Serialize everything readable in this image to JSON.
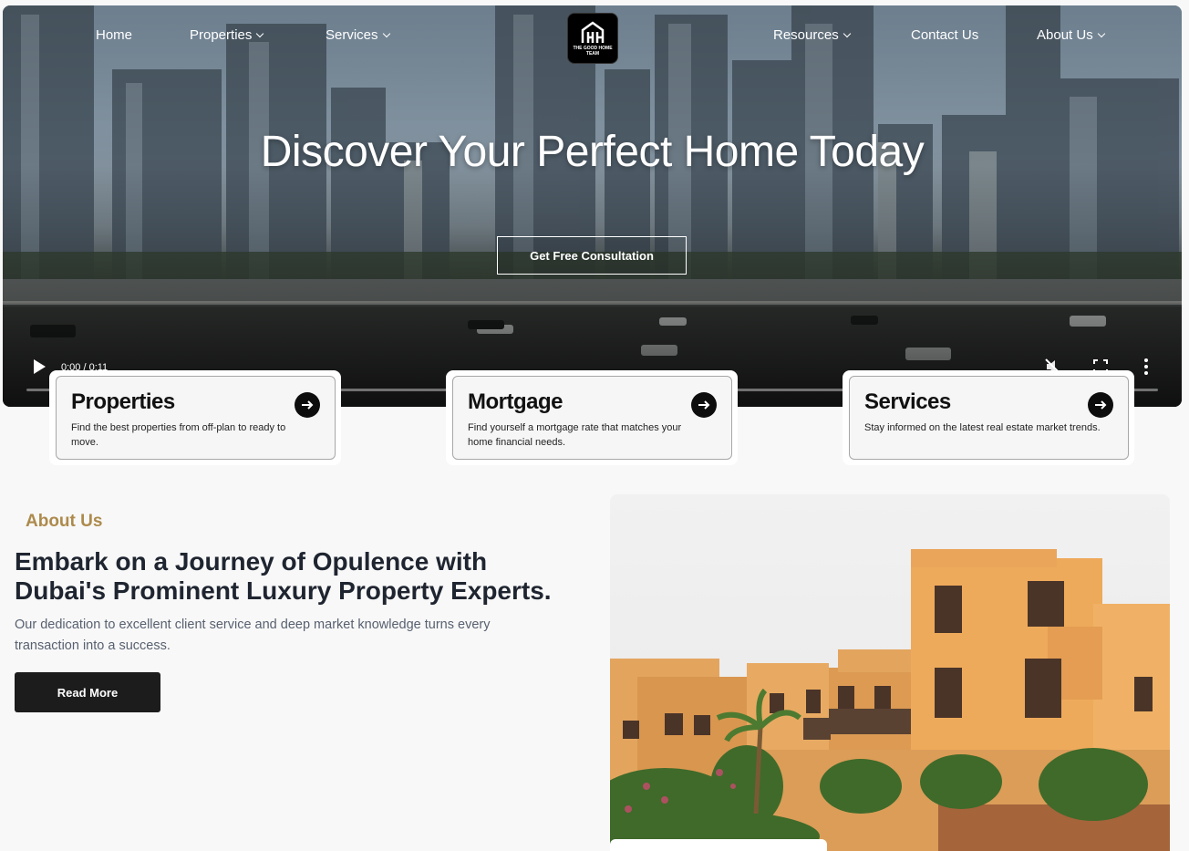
{
  "nav": {
    "items": [
      {
        "label": "Home",
        "dropdown": false
      },
      {
        "label": "Properties",
        "dropdown": true
      },
      {
        "label": "Services",
        "dropdown": true
      },
      {
        "label": "Resources",
        "dropdown": true
      },
      {
        "label": "Contact Us",
        "dropdown": false
      },
      {
        "label": "About Us",
        "dropdown": true
      }
    ]
  },
  "logo": {
    "text": "THE GOOD HOME TEAM",
    "mark": "GH"
  },
  "hero": {
    "title": "Discover Your Perfect Home Today",
    "cta_label": "Get Free Consultation"
  },
  "video": {
    "time": "0:00 / 0:11",
    "icons": [
      "play-icon",
      "mute-icon",
      "fullscreen-icon",
      "more-options-icon"
    ]
  },
  "cards": [
    {
      "title": "Properties",
      "text": "Find the best properties from off-plan to ready to move.",
      "icon": "arrow-right-icon"
    },
    {
      "title": "Mortgage",
      "text": "Find yourself a mortgage rate that matches your home financial needs.",
      "icon": "arrow-right-icon"
    },
    {
      "title": "Services",
      "text": "Stay informed on the latest real estate market trends.",
      "icon": "arrow-right-icon"
    }
  ],
  "about": {
    "label": "About Us",
    "title": "Embark on a Journey of Opulence with Dubai's Prominent Luxury Property Experts.",
    "text": "Our dedication to excellent client service and deep market knowledge turns every transaction into a success.",
    "button_label": "Read More"
  },
  "colors": {
    "accent": "#ad8a4c",
    "dark_button": "#1c1c1c",
    "body_text": "#586170",
    "heading": "#1f2530"
  }
}
